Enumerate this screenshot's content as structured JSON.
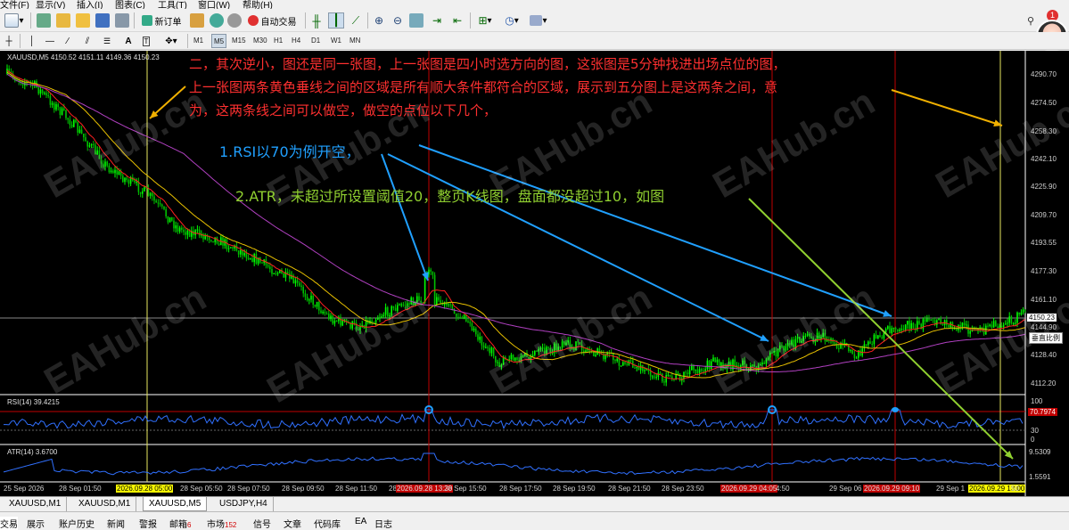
{
  "menu": [
    "文件(F)",
    "显示(V)",
    "插入(I)",
    "图表(C)",
    "工具(T)",
    "窗口(W)",
    "帮助(H)"
  ],
  "toolbar": {
    "new_order": "新订单",
    "auto_trade": "自动交易"
  },
  "timeframes": [
    "M1",
    "M5",
    "M15",
    "M30",
    "H1",
    "H4",
    "D1",
    "W1",
    "MN"
  ],
  "notification_count": "1",
  "chart": {
    "header": "XAUUSD,M5  4150.52 4151.11 4149.36 4150.23",
    "y_ticks": [
      "4290.70",
      "4274.50",
      "4258.30",
      "4242.10",
      "4225.90",
      "4209.70",
      "4193.55",
      "4177.30",
      "4161.10",
      "4144.90",
      "4128.40",
      "4112.20"
    ],
    "current_price": "4150.23",
    "vertical_scale_label": "垂直比例",
    "rsi_label": "RSI(14) 39.4215",
    "rsi_ticks": [
      "100",
      "70",
      "30",
      "0"
    ],
    "rsi_level_label": "70.7974",
    "atr_label": "ATR(14) 3.6700",
    "atr_ticks": [
      "9.5309",
      "1.5591"
    ],
    "x_ticks": [
      {
        "label": "25 Sep 2026",
        "style": ""
      },
      {
        "label": "28 Sep 01:50",
        "style": ""
      },
      {
        "label": "2026.09.28 05:00",
        "style": "hl-y"
      },
      {
        "label": "28 Sep 05:50",
        "style": ""
      },
      {
        "label": "28 Sep 07:50",
        "style": ""
      },
      {
        "label": "28 Sep 09:50",
        "style": ""
      },
      {
        "label": "28 Sep 11:50",
        "style": ""
      },
      {
        "label": "28 Sep 13:50",
        "style": ""
      },
      {
        "label": "2026.09.28 13:30",
        "style": "hl-r"
      },
      {
        "label": "28 Sep 15:50",
        "style": ""
      },
      {
        "label": "28 Sep 17:50",
        "style": ""
      },
      {
        "label": "28 Sep 19:50",
        "style": ""
      },
      {
        "label": "28 Sep 21:50",
        "style": ""
      },
      {
        "label": "28 Sep 23:50",
        "style": ""
      },
      {
        "label": "2026.09.29 04:05",
        "style": "hl-r"
      },
      {
        "label": "4:50",
        "style": ""
      },
      {
        "label": "29 Sep 06",
        "style": ""
      },
      {
        "label": "2026.09.29 09:10",
        "style": "hl-r"
      },
      {
        "label": "29 Sep 1",
        "style": ""
      },
      {
        "label": "2026.09.29 13:00",
        "style": "hl-y"
      },
      {
        "label": "50",
        "style": ""
      }
    ]
  },
  "annotations": {
    "red_line1": "二，其次逆小，图还是同一张图，上一张图是四小时选方向的图，这张图是5分钟找进出场点位的图，",
    "red_line2": "上一张图两条黄色垂线之间的区域是所有顺大条件都符合的区域，展示到五分图上是这两条之间，意",
    "red_line3": "为，这两条线之间可以做空，做空的点位以下几个，",
    "blue_text": "1.RSI以70为例开空，",
    "green_text": "2.ATR，未超过所设置阈值20，整页K线图，盘面都没超过10，如图"
  },
  "watermark": "EAHub.cn",
  "chart_tabs": [
    "XAUUSD,M1",
    "XAUUSD,M1",
    "XAUUSD,M5",
    "USDJPY,H4"
  ],
  "active_chart_tab": "XAUUSD,M5",
  "status_tabs": [
    {
      "label": "交易",
      "badge": ""
    },
    {
      "label": "展示",
      "badge": ""
    },
    {
      "label": "账户历史",
      "badge": ""
    },
    {
      "label": "新闻",
      "badge": ""
    },
    {
      "label": "警报",
      "badge": ""
    },
    {
      "label": "邮箱",
      "badge": "6"
    },
    {
      "label": "市场",
      "badge": "152"
    },
    {
      "label": "信号",
      "badge": ""
    },
    {
      "label": "文章",
      "badge": ""
    },
    {
      "label": "代码库",
      "badge": ""
    },
    {
      "label": "EA",
      "badge": ""
    },
    {
      "label": "日志",
      "badge": ""
    }
  ],
  "colors": {
    "bull": "#00ff00",
    "bear": "#00c000",
    "ma_red": "#ff2020",
    "ma_yellow": "#e8c000",
    "ma_purple": "#b040c0",
    "vline_yellow": "#e8e860",
    "vline_red": "#c00000",
    "rsi": "#3070ff",
    "annotation_red": "#ff3030",
    "annotation_blue": "#20a0ff",
    "annotation_green": "#90d030"
  }
}
